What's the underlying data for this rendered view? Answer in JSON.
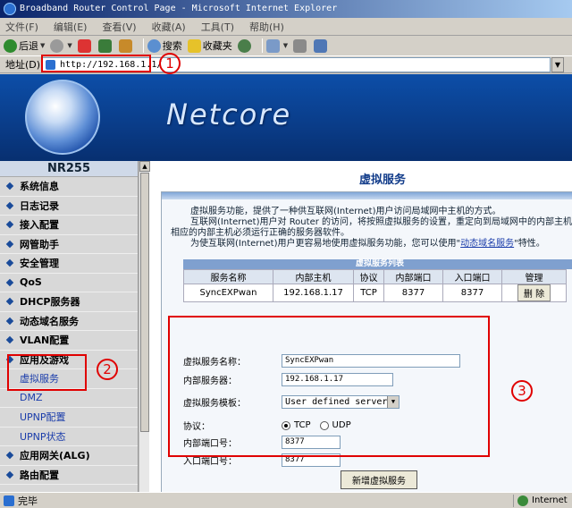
{
  "window": {
    "title": "Broadband Router Control Page - Microsoft Internet Explorer"
  },
  "menubar": {
    "items": [
      "文件(F)",
      "编辑(E)",
      "查看(V)",
      "收藏(A)",
      "工具(T)",
      "帮助(H)"
    ]
  },
  "toolbar": {
    "back": "后退",
    "search": "搜索",
    "favorites": "收藏夹"
  },
  "address": {
    "label": "地址(D)",
    "url": "http://192.168.1.1/"
  },
  "callouts": {
    "one": "1",
    "two": "2",
    "three": "3"
  },
  "banner": {
    "brand": "Netcore"
  },
  "sidebar": {
    "model": "NR255",
    "items": [
      "系统信息",
      "日志记录",
      "接入配置",
      "网管助手",
      "安全管理",
      "QoS",
      "DHCP服务器",
      "动态域名服务",
      "VLAN配置",
      "应用及游戏"
    ],
    "subitems": [
      "虚拟服务",
      "DMZ",
      "UPNP配置",
      "UPNP状态"
    ],
    "after": [
      "应用网关(ALG)",
      "路由配置"
    ]
  },
  "main": {
    "title": "虚拟服务",
    "desc1": "虚拟服务功能，提供了一种供互联网(Internet)用户访问局域网中主机的方式。",
    "desc2": "互联网(Internet)用户对 Router 的访问，将按照虚拟服务的设置，重定向到局域网中的内部主机。",
    "desc3": "相应的内部主机必须运行正确的服务器软件。",
    "desc4_pre": "为使互联网(Internet)用户更容易地使用虚拟服务功能，您可以使用\"",
    "desc4_link": "动态域名服务",
    "desc4_post": "\"特性。",
    "table_title": "虚拟服务列表",
    "table": {
      "headers": [
        "服务名称",
        "内部主机",
        "协议",
        "内部端口",
        "入口端口",
        "管理"
      ],
      "rows": [
        [
          "SyncEXPwan",
          "192.168.1.17",
          "TCP",
          "8377",
          "8377"
        ]
      ],
      "delete_label": "删 除"
    },
    "form": {
      "name_label": "虚拟服务名称：",
      "name_value": "SyncEXPwan",
      "server_label": "内部服务器：",
      "server_value": "192.168.1.17",
      "template_label": "虚拟服务模板：",
      "template_value": "User defined server",
      "protocol_label": "协议：",
      "tcp": "TCP",
      "udp": "UDP",
      "inport_label": "内部端口号：",
      "inport_value": "8377",
      "outport_label": "入口端口号：",
      "outport_value": "8377",
      "add_button": "新增虚拟服务"
    }
  },
  "status": {
    "text": "完毕",
    "zone": "Internet"
  }
}
